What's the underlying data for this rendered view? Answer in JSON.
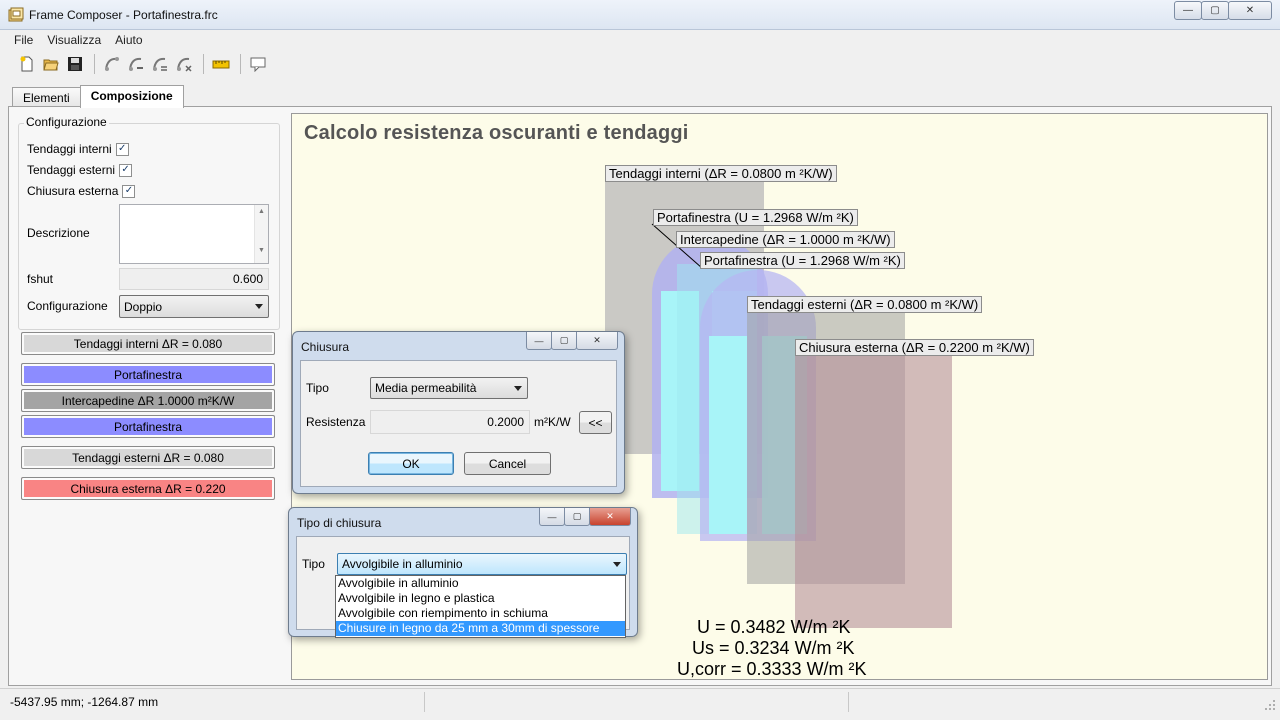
{
  "window": {
    "title": "Frame Composer - Portafinestra.frc",
    "minimize": "—",
    "maximize": "▢",
    "close": "✕"
  },
  "menu": [
    "File",
    "Visualizza",
    "Aiuto"
  ],
  "toolbar": {
    "icons": [
      "new-file-icon",
      "open-folder-icon",
      "save-icon",
      "node-add-icon",
      "node-edit-icon",
      "node-move-icon",
      "node-delete-icon",
      "ruler-icon",
      "comment-icon"
    ]
  },
  "tabs": [
    "Elementi",
    "Composizione"
  ],
  "left": {
    "group_title": "Configurazione",
    "checkboxes": [
      {
        "label": "Tendaggi interni",
        "checked": true
      },
      {
        "label": "Tendaggi esterni",
        "checked": true
      },
      {
        "label": "Chiusura esterna",
        "checked": true
      }
    ],
    "desc_label": "Descrizione",
    "desc_value": "",
    "fshut_label": "fshut",
    "fshut_value": "0.600",
    "conf_label": "Configurazione",
    "conf_value": "Doppio",
    "layers": [
      {
        "label": "Tendaggi interni ΔR = 0.080",
        "color": "#d8d8d8"
      },
      {
        "label": "Portafinestra",
        "color": "#8c8cff"
      },
      {
        "label": "Intercapedine ΔR 1.0000 m²K/W",
        "color": "#a4a4a4"
      },
      {
        "label": "Portafinestra",
        "color": "#8c8cff"
      },
      {
        "label": "Tendaggi esterni ΔR = 0.080",
        "color": "#d8d8d8"
      },
      {
        "label": "Chiusura esterna ΔR = 0.220",
        "color": "#f98484"
      }
    ]
  },
  "canvas": {
    "title": "Calcolo resistenza oscuranti e tendaggi",
    "labels": {
      "tend_int": "Tendaggi interni (ΔR = 0.0800 m ²K/W)",
      "porta1": "Portafinestra (U = 1.2968 W/m ²K)",
      "interc": "Intercapedine (ΔR = 1.0000 m ²K/W)",
      "porta2": "Portafinestra (U = 1.2968 W/m ²K)",
      "tend_est": "Tendaggi esterni (ΔR = 0.0800 m ²K/W)",
      "chius": "Chiusura esterna (ΔR = 0.2200 m ²K/W)"
    },
    "results": {
      "u": "U = 0.3482 W/m ²K",
      "us": "Us = 0.3234 W/m ²K",
      "ucorr": "U,corr = 0.3333 W/m ²K"
    }
  },
  "dialog_chiusura": {
    "title": "Chiusura",
    "tipo_label": "Tipo",
    "tipo_value": "Media permeabilità",
    "res_label": "Resistenza",
    "res_value": "0.2000",
    "res_unit": "m²K/W",
    "back_btn": "<<",
    "ok": "OK",
    "cancel": "Cancel"
  },
  "dialog_tipo": {
    "title": "Tipo di chiusura",
    "tipo_label": "Tipo",
    "selected": "Avvolgibile in alluminio",
    "options": [
      "Avvolgibile in alluminio",
      "Avvolgibile in legno e plastica",
      "Avvolgibile con riempimento in schiuma",
      "Chiusure in legno da 25 mm a 30mm di spessore"
    ],
    "highlighted_index": 3
  },
  "status": {
    "coords": "-5437.95 mm; -1264.87 mm"
  }
}
